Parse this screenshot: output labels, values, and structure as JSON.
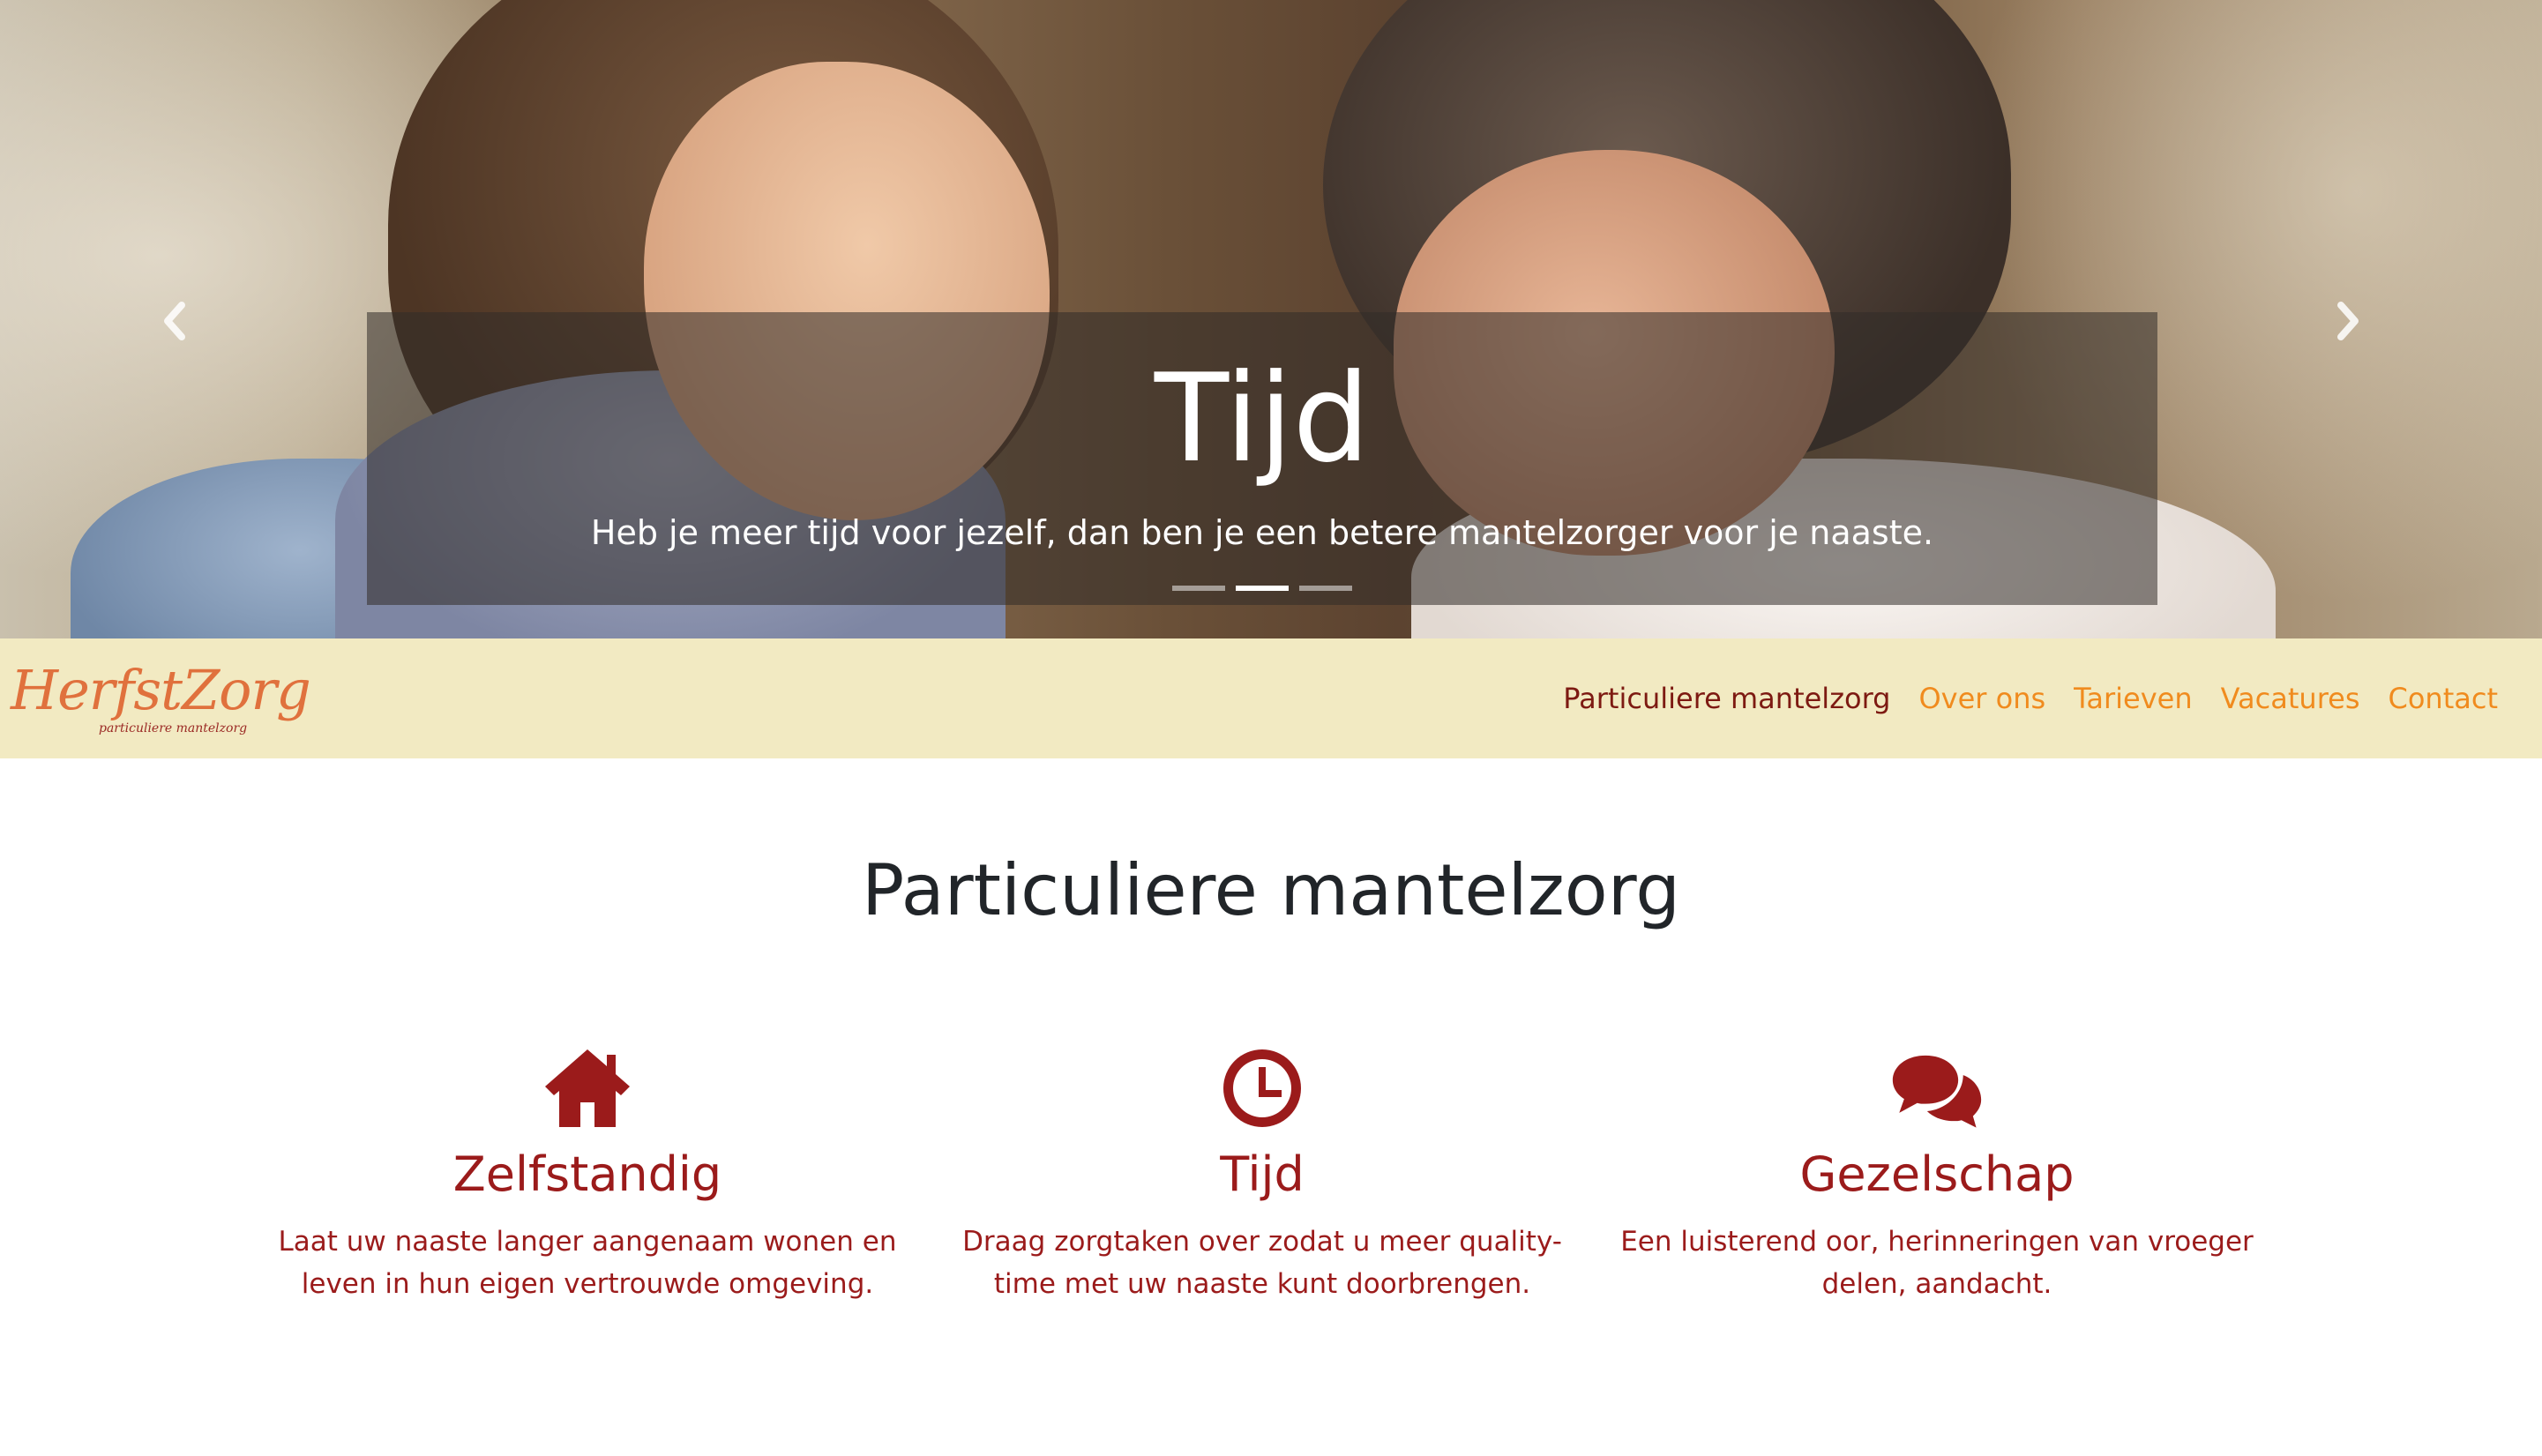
{
  "hero": {
    "title": "Tijd",
    "text": "Heb je meer tijd voor jezelf, dan ben je een betere mantelzorger voor je naaste.",
    "prev_icon": "chevron-left-icon",
    "next_icon": "chevron-right-icon",
    "slides": 3,
    "active_slide": 2
  },
  "navbar": {
    "logo_text": "HerfstZorg",
    "logo_subtext": "particuliere mantelzorg",
    "links": [
      {
        "label": "Particuliere mantelzorg",
        "active": true
      },
      {
        "label": "Over ons",
        "active": false
      },
      {
        "label": "Tarieven",
        "active": false
      },
      {
        "label": "Vacatures",
        "active": false
      },
      {
        "label": "Contact",
        "active": false
      }
    ]
  },
  "main": {
    "title": "Particuliere mantelzorg",
    "features": [
      {
        "icon": "home-icon",
        "title": "Zelfstandig",
        "text": "Laat uw naaste langer aangenaam wonen en leven in hun eigen vertrouwde omgeving."
      },
      {
        "icon": "clock-icon",
        "title": "Tijd",
        "text": "Draag zorgtaken over zodat u meer quality-time met uw naaste kunt doorbrengen."
      },
      {
        "icon": "comments-icon",
        "title": "Gezelschap",
        "text": "Een luisterend oor, herinneringen van vroeger delen, aandacht."
      }
    ]
  },
  "colors": {
    "navbar_bg": "#f2eac2",
    "nav_link": "#f08b1e",
    "nav_link_active": "#7d1a12",
    "accent_red": "#9b1b1b",
    "logo_orange": "#e0713d"
  }
}
